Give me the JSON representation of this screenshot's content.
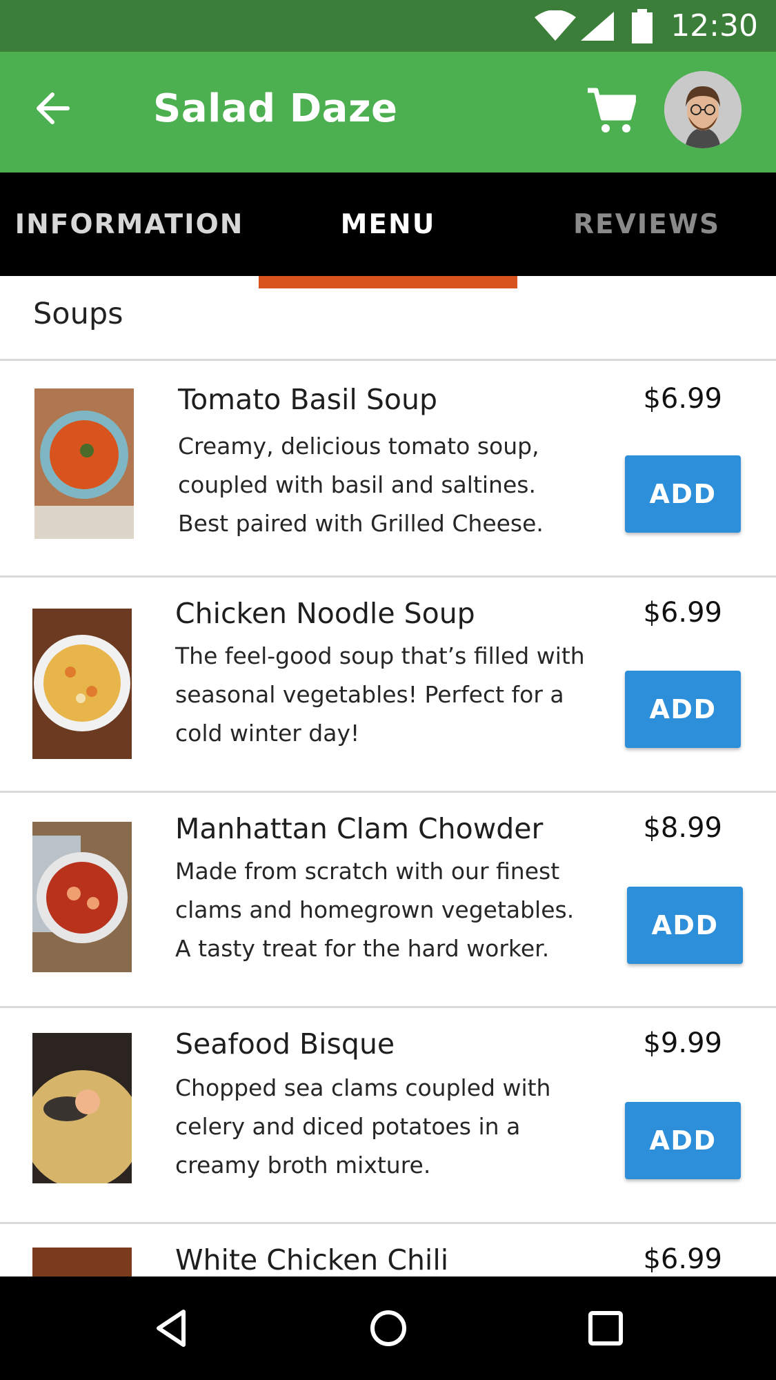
{
  "status_bar": {
    "time": "12:30"
  },
  "app_bar": {
    "title": "Salad Daze"
  },
  "tabs": [
    {
      "label": "INFORMATION"
    },
    {
      "label": "MENU"
    },
    {
      "label": "REVIEWS"
    }
  ],
  "menu": {
    "section": "Soups",
    "items": [
      {
        "name": "Tomato Basil Soup",
        "description": "Creamy, delicious tomato soup, coupled with basil and saltines. Best paired with Grilled Cheese.",
        "price": "$6.99",
        "button": "ADD"
      },
      {
        "name": "Chicken Noodle Soup",
        "description": "The feel-good soup that’s filled with seasonal vegetables! Perfect for a cold winter day!",
        "price": "$6.99",
        "button": "ADD"
      },
      {
        "name": "Manhattan Clam Chowder",
        "description": "Made from scratch with our finest clams and homegrown vegetables. A tasty treat for the hard worker.",
        "price": "$8.99",
        "button": "ADD"
      },
      {
        "name": "Seafood Bisque",
        "description": "Chopped sea clams coupled with celery and diced potatoes in a creamy broth mixture.",
        "price": "$9.99",
        "button": "ADD"
      },
      {
        "name": "White Chicken Chili",
        "price": "$6.99"
      }
    ]
  },
  "colors": {
    "status_bar": "#3a7e39",
    "app_bar": "#4caf50",
    "tab_indicator": "#d8541e",
    "add_button": "#2d8fd9"
  },
  "icons": {
    "status": [
      "wifi-icon",
      "signal-icon",
      "battery-icon"
    ],
    "app_bar": [
      "back-arrow-icon",
      "cart-icon",
      "avatar"
    ],
    "nav": [
      "nav-back-icon",
      "nav-home-icon",
      "nav-recents-icon"
    ]
  }
}
